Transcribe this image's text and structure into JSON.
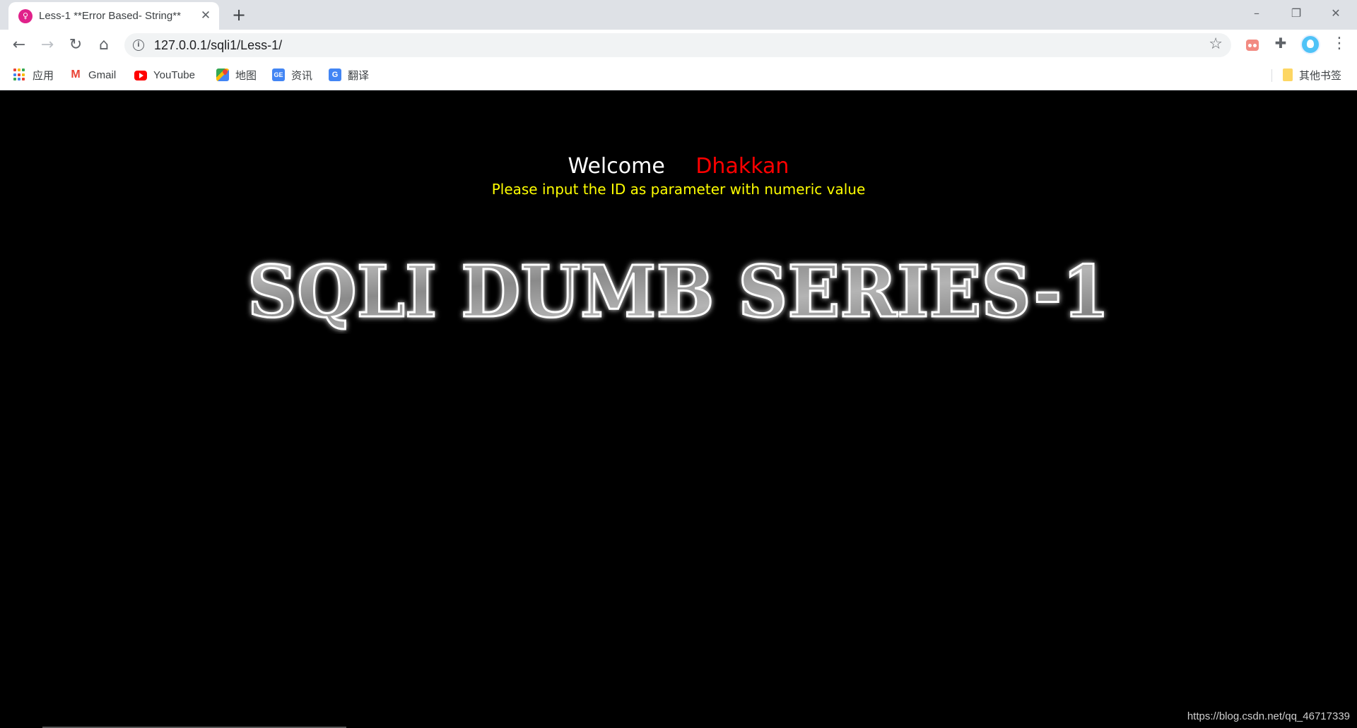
{
  "browser": {
    "tab": {
      "title": "Less-1 **Error Based- String**",
      "favicon": "php-icon"
    },
    "new_tab_label": "+",
    "window_controls": {
      "minimize": "–",
      "restore": "❐",
      "close": "✕"
    },
    "address": "127.0.0.1/sqli1/Less-1/",
    "bookmarks": [
      {
        "label": "应用",
        "icon": "apps-icon"
      },
      {
        "label": "Gmail",
        "icon": "gmail-icon"
      },
      {
        "label": "YouTube",
        "icon": "youtube-icon"
      },
      {
        "label": "地图",
        "icon": "maps-icon"
      },
      {
        "label": "资讯",
        "icon": "news-icon"
      },
      {
        "label": "翻译",
        "icon": "translate-icon"
      }
    ],
    "other_bookmarks": "其他书签"
  },
  "page": {
    "welcome": "Welcome",
    "name": "Dhakkan",
    "instruction": "Please input the ID as parameter with numeric value",
    "banner": "SQLI DUMB SERIES-1",
    "watermark": "https://blog.csdn.net/qq_46717339"
  },
  "colors": {
    "page_background": "#000000",
    "welcome": "#ffffff",
    "name": "#ff0000",
    "instruction": "#ffff00"
  }
}
